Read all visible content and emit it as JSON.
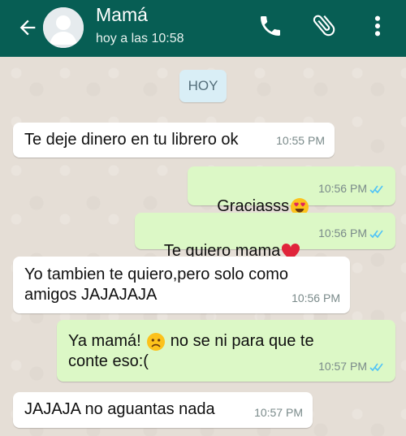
{
  "header": {
    "contact_name": "Mamá",
    "status": "hoy a las 10:58",
    "icons": [
      "back-arrow-icon",
      "avatar",
      "phone-icon",
      "paperclip-icon",
      "more-vertical-icon"
    ]
  },
  "date_chip": "HOY",
  "messages": [
    {
      "direction": "in",
      "text": "Te deje dinero en tu librero ok",
      "time": "10:55 PM"
    },
    {
      "direction": "out",
      "text": "Graciasss",
      "emoji": "heart-eyes-emoji",
      "time": "10:56 PM",
      "read": true
    },
    {
      "direction": "out",
      "text": "Te quiero mama",
      "emoji": "red-heart-emoji",
      "time": "10:56 PM",
      "read": true
    },
    {
      "direction": "in",
      "text_lines": [
        "Yo tambien te quiero,pero solo como",
        "amigos JAJAJAJA"
      ],
      "time": "10:56 PM"
    },
    {
      "direction": "out",
      "text_lines": [
        "Ya mamá!",
        "no se ni para que te",
        "conte eso:("
      ],
      "emoji": "frowning-face-emoji",
      "time": "10:57 PM",
      "read": true
    },
    {
      "direction": "in",
      "text": "JAJAJA no aguantas nada",
      "time": "10:57 PM"
    }
  ],
  "colors": {
    "header": "#075e54",
    "chat_background": "#e5ded6",
    "incoming_bubble": "#ffffff",
    "outgoing_bubble": "#dcf8c6",
    "read_ticks": "#4fc3f7"
  }
}
